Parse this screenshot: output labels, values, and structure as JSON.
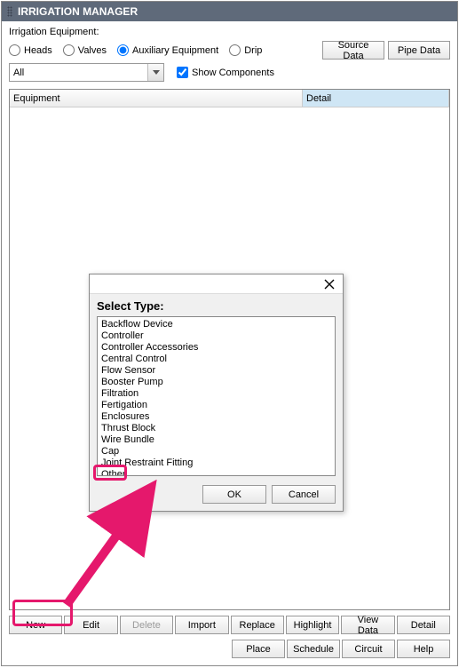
{
  "title": "IRRIGATION MANAGER",
  "equip_label": "Irrigation Equipment:",
  "radios": {
    "heads": "Heads",
    "valves": "Valves",
    "aux": "Auxiliary Equipment",
    "drip": "Drip"
  },
  "radio_selected": "aux",
  "topbtns": {
    "source": "Source Data",
    "pipe": "Pipe Data"
  },
  "combo_value": "All",
  "show_components": "Show Components",
  "cols": {
    "equipment": "Equipment",
    "detail": "Detail"
  },
  "bottom_buttons": [
    "New",
    "Edit",
    "Delete",
    "Import",
    "Replace",
    "Highlight",
    "View Data",
    "Detail"
  ],
  "bottom2": [
    "Place",
    "Schedule",
    "Circuit",
    "Help"
  ],
  "dialog": {
    "heading": "Select Type:",
    "items": [
      "Backflow Device",
      "Controller",
      "Controller Accessories",
      "Central Control",
      "Flow Sensor",
      "Booster Pump",
      "Filtration",
      "Fertigation",
      "Enclosures",
      "Thrust Block",
      "Wire Bundle",
      "Cap",
      "Joint Restraint Fitting",
      "Other"
    ],
    "ok": "OK",
    "cancel": "Cancel"
  }
}
